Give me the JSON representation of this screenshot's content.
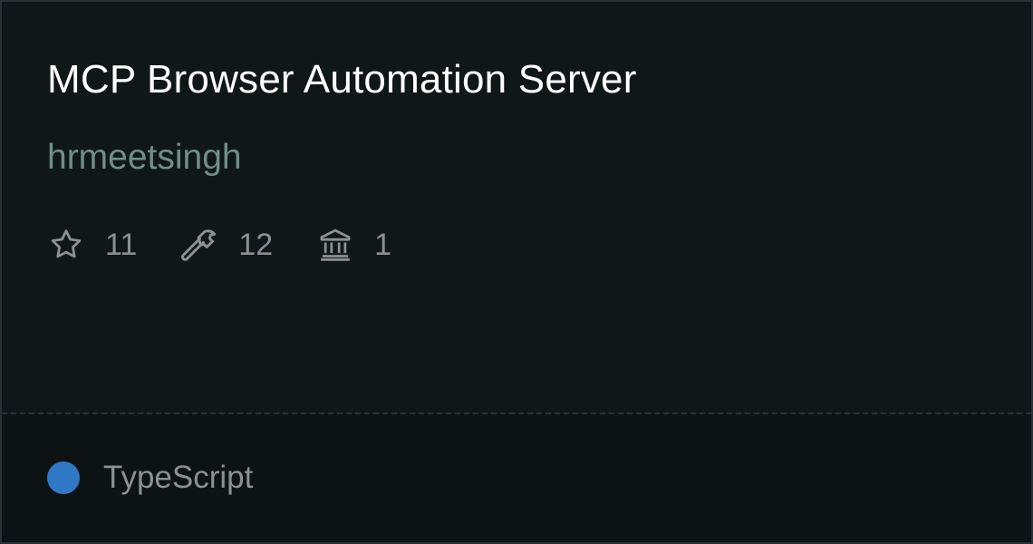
{
  "repo": {
    "title": "MCP Browser Automation Server",
    "author": "hrmeetsingh"
  },
  "stats": {
    "stars": {
      "icon": "star-icon",
      "value": "11"
    },
    "tools": {
      "icon": "hammer-icon",
      "value": "12"
    },
    "resources": {
      "icon": "bank-icon",
      "value": "1"
    }
  },
  "language": {
    "name": "TypeScript",
    "color": "#3178c6"
  },
  "colors": {
    "background": "#101719",
    "title": "#ffffff",
    "author": "#6f8e87",
    "muted": "#8b9093"
  }
}
